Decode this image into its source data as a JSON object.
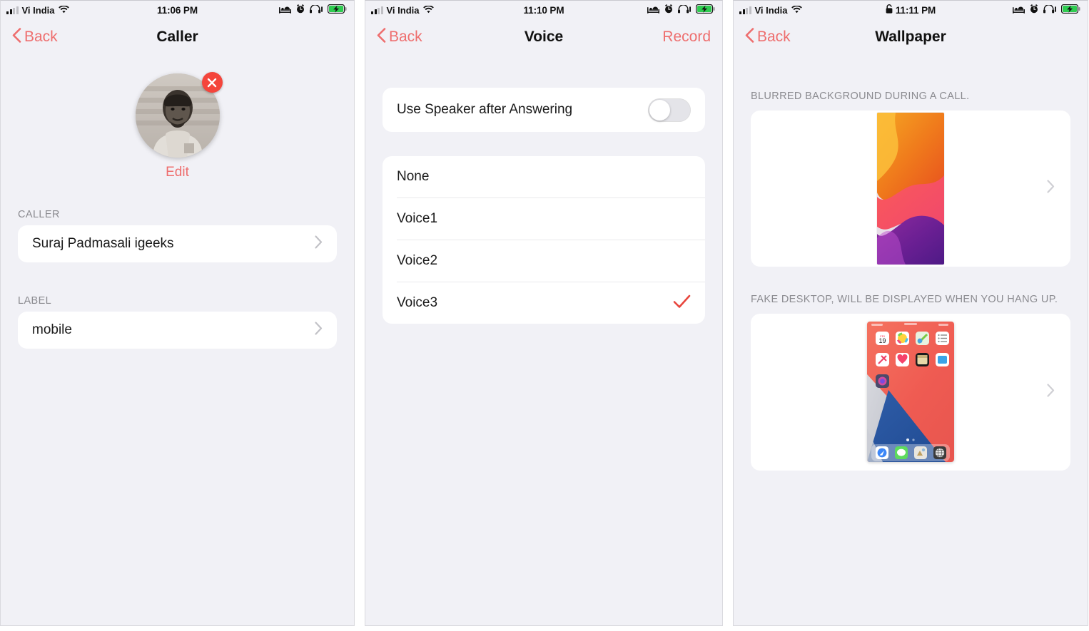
{
  "panels": [
    {
      "id": "caller",
      "statusbar": {
        "carrier": "Vi India",
        "time": "11:06 PM",
        "has_lock": false,
        "icons": [
          "signal-bars-icon",
          "wifi-icon",
          "bed-icon",
          "alarm-clock-icon",
          "headphones-icon",
          "battery-charging-icon"
        ]
      },
      "nav": {
        "back": "Back",
        "title": "Caller",
        "action": ""
      },
      "avatar": {
        "edit": "Edit",
        "delete_badge": "×"
      },
      "sections": [
        {
          "header": "CALLER",
          "rows": [
            {
              "label": "Suraj Padmasali igeeks",
              "accessory": "chevron"
            }
          ]
        },
        {
          "header": "LABEL",
          "rows": [
            {
              "label": "mobile",
              "accessory": "chevron"
            }
          ]
        }
      ]
    },
    {
      "id": "voice",
      "statusbar": {
        "carrier": "Vi India",
        "time": "11:10 PM",
        "has_lock": false,
        "icons": [
          "signal-bars-icon",
          "wifi-icon",
          "bed-icon",
          "alarm-clock-icon",
          "headphones-icon",
          "battery-charging-icon"
        ]
      },
      "nav": {
        "back": "Back",
        "title": "Voice",
        "action": "Record"
      },
      "speaker_row": {
        "label": "Use Speaker after Answering",
        "enabled": false
      },
      "voice_options": [
        {
          "label": "None",
          "selected": false
        },
        {
          "label": "Voice1",
          "selected": false
        },
        {
          "label": "Voice2",
          "selected": false
        },
        {
          "label": "Voice3",
          "selected": true
        }
      ]
    },
    {
      "id": "wallpaper",
      "statusbar": {
        "carrier": "Vi India",
        "time": "11:11 PM",
        "has_lock": true,
        "icons": [
          "signal-bars-icon",
          "wifi-icon",
          "lock-icon",
          "bed-icon",
          "alarm-clock-icon",
          "headphones-icon",
          "battery-charging-icon"
        ]
      },
      "nav": {
        "back": "Back",
        "title": "Wallpaper",
        "action": ""
      },
      "sections": [
        {
          "caption": "BLURRED BACKGROUND DURING A CALL.",
          "thumb": "ios13-gradient-wallpaper",
          "accessory": "chevron"
        },
        {
          "caption": "FAKE DESKTOP, WILL BE DISPLAYED WHEN YOU HANG UP.",
          "thumb": "ios14-homescreen",
          "accessory": "chevron"
        }
      ]
    }
  ],
  "colors": {
    "accent_red": "#ee6e6e",
    "check_red": "#e8453c",
    "delete_red": "#f4453c",
    "background": "#f1f1f6",
    "card": "#ffffff",
    "secondary_text": "#8b8b90",
    "chevron": "#c2c2c7"
  }
}
